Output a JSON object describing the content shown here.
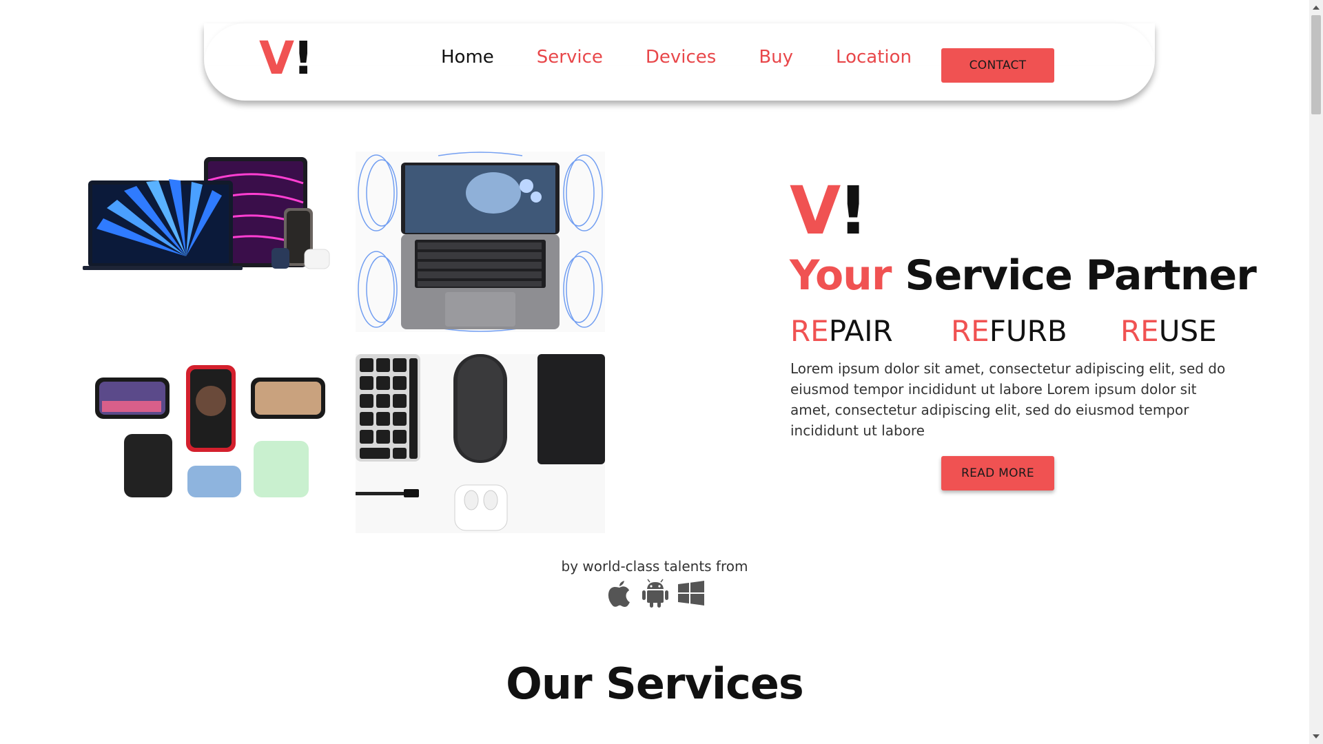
{
  "nav": {
    "logo_v": "V",
    "logo_bang": "!",
    "links": [
      {
        "label": "Home",
        "active": true
      },
      {
        "label": "Service",
        "active": false
      },
      {
        "label": "Devices",
        "active": false
      },
      {
        "label": "Buy",
        "active": false
      },
      {
        "label": "Location",
        "active": false
      }
    ],
    "contact_label": "CONTACT"
  },
  "hero": {
    "logo_v": "V",
    "logo_bang": "!",
    "tagline_red": "Your",
    "tagline_dark": "Service Partner",
    "re_words": [
      {
        "prefix": "RE",
        "rest": "PAIR"
      },
      {
        "prefix": "RE",
        "rest": "FURB"
      },
      {
        "prefix": "RE",
        "rest": "USE"
      }
    ],
    "description": "Lorem ipsum dolor sit amet, consectetur adipiscing elit, sed do eiusmod tempor incididunt ut labore Lorem ipsum dolor sit amet, consectetur adipiscing elit, sed do eiusmod tempor incididunt ut labore",
    "read_more_label": "READ MORE"
  },
  "hero_images": [
    {
      "icon": "laptop-tablet-phone-image"
    },
    {
      "icon": "macbook-image"
    },
    {
      "icon": "iphones-image"
    },
    {
      "icon": "accessories-image"
    }
  ],
  "talents": {
    "text": "by world-class talents from",
    "platforms": [
      "apple-icon",
      "android-icon",
      "windows-icon"
    ]
  },
  "services": {
    "title": "Our Services"
  },
  "colors": {
    "accent": "#f05252",
    "nav_link": "#e8474a",
    "text_dark": "#111111"
  }
}
